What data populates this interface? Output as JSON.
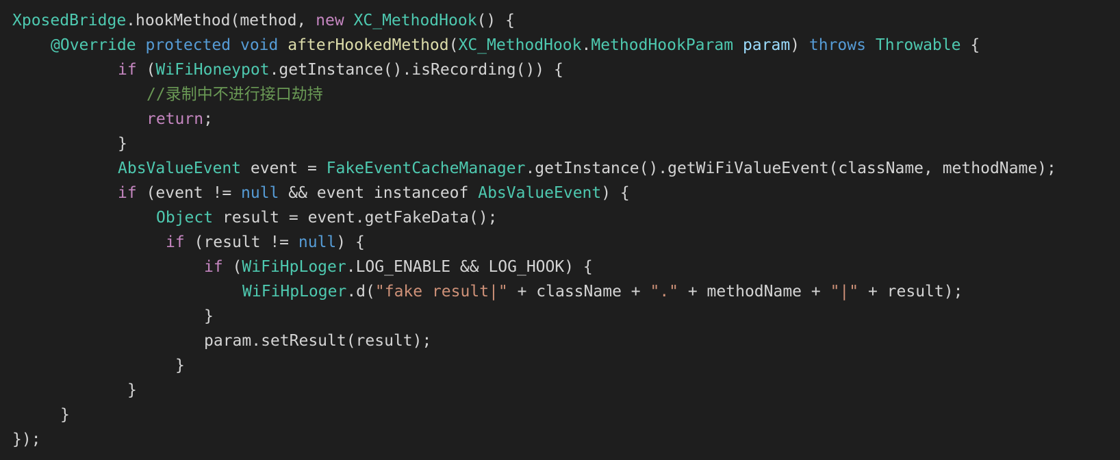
{
  "editor": {
    "language": "java",
    "theme_colors": {
      "background": "#1e1e1e",
      "plain": "#d4d4d4",
      "type": "#4ec9b0",
      "keyword": "#c586c0",
      "storage": "#569cd6",
      "function": "#dcdcaa",
      "parameter": "#9cdcfe",
      "string": "#ce9178",
      "comment": "#6a9955"
    },
    "lines": [
      {
        "indent": 0,
        "tokens": [
          {
            "t": "XposedBridge",
            "c": "type"
          },
          {
            "t": ".hookMethod(method, ",
            "c": "plain"
          },
          {
            "t": "new",
            "c": "keyword"
          },
          {
            "t": " ",
            "c": "plain"
          },
          {
            "t": "XC_MethodHook",
            "c": "type"
          },
          {
            "t": "() {",
            "c": "plain"
          }
        ]
      },
      {
        "indent": 4,
        "tokens": [
          {
            "t": "@Override",
            "c": "annotation"
          },
          {
            "t": " ",
            "c": "plain"
          },
          {
            "t": "protected",
            "c": "storage"
          },
          {
            "t": " ",
            "c": "plain"
          },
          {
            "t": "void",
            "c": "storage"
          },
          {
            "t": " ",
            "c": "plain"
          },
          {
            "t": "afterHookedMethod",
            "c": "func"
          },
          {
            "t": "(",
            "c": "plain"
          },
          {
            "t": "XC_MethodHook",
            "c": "type"
          },
          {
            "t": ".",
            "c": "plain"
          },
          {
            "t": "MethodHookParam",
            "c": "type"
          },
          {
            "t": " ",
            "c": "plain"
          },
          {
            "t": "param",
            "c": "param"
          },
          {
            "t": ") ",
            "c": "plain"
          },
          {
            "t": "throws",
            "c": "storage"
          },
          {
            "t": " ",
            "c": "plain"
          },
          {
            "t": "Throwable",
            "c": "type"
          },
          {
            "t": " {",
            "c": "plain"
          }
        ]
      },
      {
        "indent": 11,
        "tokens": [
          {
            "t": "if",
            "c": "keyword"
          },
          {
            "t": " (",
            "c": "plain"
          },
          {
            "t": "WiFiHoneypot",
            "c": "type"
          },
          {
            "t": ".getInstance().isRecording()) {",
            "c": "plain"
          }
        ]
      },
      {
        "indent": 14,
        "tokens": [
          {
            "t": "//录制中不进行接口劫持",
            "c": "comment"
          }
        ]
      },
      {
        "indent": 14,
        "tokens": [
          {
            "t": "return",
            "c": "keyword"
          },
          {
            "t": ";",
            "c": "plain"
          }
        ]
      },
      {
        "indent": 11,
        "tokens": [
          {
            "t": "}",
            "c": "plain"
          }
        ]
      },
      {
        "indent": 11,
        "tokens": [
          {
            "t": "AbsValueEvent",
            "c": "type"
          },
          {
            "t": " event = ",
            "c": "plain"
          },
          {
            "t": "FakeEventCacheManager",
            "c": "type"
          },
          {
            "t": ".getInstance().getWiFiValueEvent(className, methodName);",
            "c": "plain"
          }
        ]
      },
      {
        "indent": 11,
        "tokens": [
          {
            "t": "if",
            "c": "keyword"
          },
          {
            "t": " (event != ",
            "c": "plain"
          },
          {
            "t": "null",
            "c": "storage"
          },
          {
            "t": " && event instanceof ",
            "c": "plain"
          },
          {
            "t": "AbsValueEvent",
            "c": "type"
          },
          {
            "t": ") {",
            "c": "plain"
          }
        ]
      },
      {
        "indent": 15,
        "tokens": [
          {
            "t": "Object",
            "c": "type"
          },
          {
            "t": " result = event.getFakeData();",
            "c": "plain"
          }
        ]
      },
      {
        "indent": 16,
        "tokens": [
          {
            "t": "if",
            "c": "keyword"
          },
          {
            "t": " (result != ",
            "c": "plain"
          },
          {
            "t": "null",
            "c": "storage"
          },
          {
            "t": ") {",
            "c": "plain"
          }
        ]
      },
      {
        "indent": 20,
        "tokens": [
          {
            "t": "if",
            "c": "keyword"
          },
          {
            "t": " (",
            "c": "plain"
          },
          {
            "t": "WiFiHpLoger",
            "c": "type"
          },
          {
            "t": ".LOG_ENABLE && LOG_HOOK) {",
            "c": "plain"
          }
        ]
      },
      {
        "indent": 24,
        "tokens": [
          {
            "t": "WiFiHpLoger",
            "c": "type"
          },
          {
            "t": ".d(",
            "c": "plain"
          },
          {
            "t": "\"fake result|\"",
            "c": "string"
          },
          {
            "t": " + className + ",
            "c": "plain"
          },
          {
            "t": "\".\"",
            "c": "string"
          },
          {
            "t": " + methodName + ",
            "c": "plain"
          },
          {
            "t": "\"|\"",
            "c": "string"
          },
          {
            "t": " + result);",
            "c": "plain"
          }
        ]
      },
      {
        "indent": 20,
        "tokens": [
          {
            "t": "}",
            "c": "plain"
          }
        ]
      },
      {
        "indent": 20,
        "tokens": [
          {
            "t": "param.setResult(result);",
            "c": "plain"
          }
        ]
      },
      {
        "indent": 17,
        "tokens": [
          {
            "t": "}",
            "c": "plain"
          }
        ]
      },
      {
        "indent": 12,
        "tokens": [
          {
            "t": "}",
            "c": "plain"
          }
        ]
      },
      {
        "indent": 5,
        "tokens": [
          {
            "t": "}",
            "c": "plain"
          }
        ]
      },
      {
        "indent": 0,
        "tokens": [
          {
            "t": "});",
            "c": "plain"
          }
        ]
      }
    ]
  }
}
